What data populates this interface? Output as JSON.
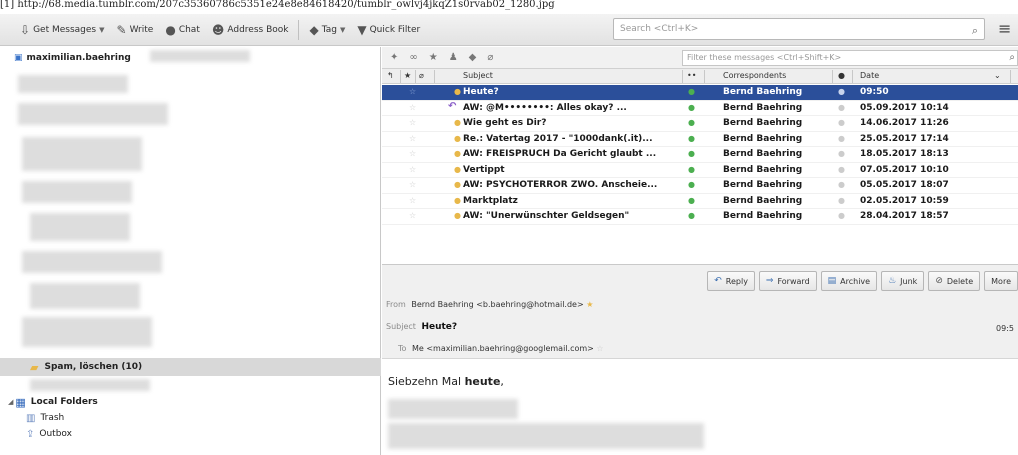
{
  "url_line": "[1] http://68.media.tumblr.com/207c35360786c5351e24e8e84618420/tumblr_owlvj4jkqZ1s0rvab02_1280.jpg",
  "toolbar": {
    "get_messages": "Get Messages",
    "write": "Write",
    "chat": "Chat",
    "address_book": "Address Book",
    "tag": "Tag",
    "quick_filter": "Quick Filter",
    "search_placeholder": "Search <Ctrl+K>"
  },
  "folders": {
    "account": "maximilian.baehring",
    "spam": "Spam, löschen (10)",
    "local_folders": "Local Folders",
    "trash": "Trash",
    "outbox": "Outbox"
  },
  "message_list": {
    "filter_placeholder": "Filter these messages <Ctrl+Shift+K>",
    "columns": {
      "subject": "Subject",
      "correspondents": "Correspondents",
      "date": "Date"
    },
    "rows": [
      {
        "subject": "Heute?",
        "correspondent": "Bernd Baehring",
        "date": "09:50",
        "selected": true,
        "icon": "dot"
      },
      {
        "subject": "AW: @M••••••••: Alles okay? ...",
        "correspondent": "Bernd Baehring",
        "date": "05.09.2017 10:14",
        "selected": false,
        "icon": "reply"
      },
      {
        "subject": "Wie geht es Dir?",
        "correspondent": "Bernd Baehring",
        "date": "14.06.2017 11:26",
        "selected": false,
        "icon": "dot"
      },
      {
        "subject": "Re.: Vatertag 2017 - \"1000dank(.it)...",
        "correspondent": "Bernd Baehring",
        "date": "25.05.2017 17:14",
        "selected": false,
        "icon": "dot"
      },
      {
        "subject": "AW: FREISPRUCH Da Gericht glaubt ...",
        "correspondent": "Bernd Baehring",
        "date": "18.05.2017 18:13",
        "selected": false,
        "icon": "dot"
      },
      {
        "subject": "Vertippt",
        "correspondent": "Bernd Baehring",
        "date": "07.05.2017 10:10",
        "selected": false,
        "icon": "dot"
      },
      {
        "subject": "AW: PSYCHOTERROR ZWO. Anscheie...",
        "correspondent": "Bernd Baehring",
        "date": "05.05.2017 18:07",
        "selected": false,
        "icon": "dot"
      },
      {
        "subject": "Marktplatz",
        "correspondent": "Bernd Baehring",
        "date": "02.05.2017 10:59",
        "selected": false,
        "icon": "dot"
      },
      {
        "subject": "AW: \"Unerwünschter Geldsegen\"",
        "correspondent": "Bernd Baehring",
        "date": "28.04.2017 18:57",
        "selected": false,
        "icon": "dot"
      }
    ]
  },
  "actions": {
    "reply": "Reply",
    "forward": "Forward",
    "archive": "Archive",
    "junk": "Junk",
    "delete": "Delete",
    "more": "More"
  },
  "header": {
    "from_label": "From",
    "from_value": "Bernd Baehring <b.baehring@hotmail.de>",
    "subject_label": "Subject",
    "subject_value": "Heute?",
    "time": "09:5",
    "to_label": "To",
    "to_value": "Me <maximilian.baehring@googlemail.com>"
  },
  "body": {
    "text_prefix": "Siebzehn Mal",
    "text_bold": "heute",
    "text_suffix": ","
  },
  "colors": {
    "selection": "#2b4f9a",
    "unread_dot": "#e8b84a",
    "online_dot": "#4caf50"
  }
}
